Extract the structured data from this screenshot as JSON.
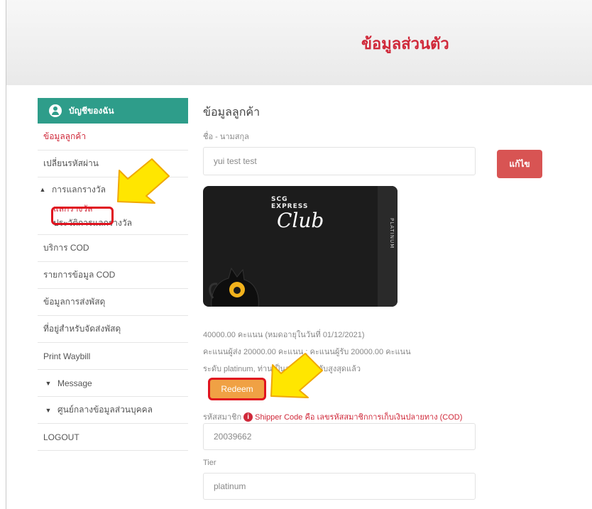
{
  "page": {
    "title": "ข้อมูลส่วนตัว"
  },
  "sidebar": {
    "account_label": "บัญชีของฉัน",
    "items_top": [
      {
        "label": "ข้อมูลลูกค้า",
        "active": true
      },
      {
        "label": "เปลี่ยนรหัสผ่าน",
        "active": false
      }
    ],
    "rewards_group": {
      "label": "การแลกรางวัล",
      "sub_items": [
        {
          "label": "แลกรางวัล",
          "active": true
        },
        {
          "label": "ประวัติการแลกรางวัล",
          "active": false
        }
      ]
    },
    "items_mid": [
      {
        "label": "บริการ COD"
      },
      {
        "label": "รายการข้อมูล COD"
      },
      {
        "label": "ข้อมูลการส่งพัสดุ"
      },
      {
        "label": "ที่อยู่สำหรับจัดส่งพัสดุ"
      },
      {
        "label": "Print Waybill"
      }
    ],
    "message_label": "Message",
    "privacy_label": "ศูนย์กลางข้อมูลส่วนบุคคล",
    "logout_label": "LOGOUT"
  },
  "main": {
    "section_title": "ข้อมูลลูกค้า",
    "name_label": "ชื่อ - นามสกุล",
    "name_value": "yui test test",
    "edit_label": "แก้ไข",
    "card": {
      "brand_line1": "SCG",
      "brand_line2": "EXPRESS",
      "club_text": "Club",
      "tier_vertical": "PLATINUM"
    },
    "points_line": "40000.00 คะแนน (หมดอายุในวันที่ 01/12/2021)",
    "points_detail_line": "คะแนนผู้ส่ง 20000.00 คะแนน : คะแนนผู้รับ 20000.00 คะแนน",
    "tier_line": "ระดับ platinum, ท่านเป็นสมาชิกระดับสูงสุดแล้ว",
    "redeem_label": "Redeem",
    "member_code_label": "รหัสสมาชิก",
    "shipper_note": "Shipper Code คือ เลขรหัสสมาชิกการเก็บเงินปลายทาง (COD)",
    "member_code_value": "20039662",
    "tier_label": "Tier",
    "tier_value": "platinum"
  },
  "colors": {
    "accent_red": "#d0293a",
    "teal": "#2e9d8a",
    "orange": "#f0a144",
    "arrow_yellow": "#ffe600"
  }
}
